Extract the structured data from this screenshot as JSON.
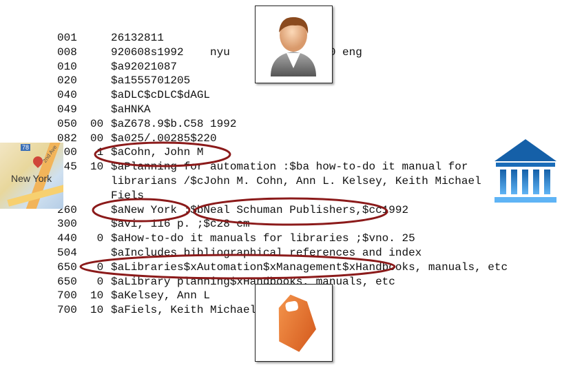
{
  "record": [
    {
      "tag": "001",
      "ind": "",
      "value": "26132811"
    },
    {
      "tag": "008",
      "ind": "",
      "value": "920608s1992    nyu           000 0 eng"
    },
    {
      "tag": "010",
      "ind": "",
      "value": "$a92021087"
    },
    {
      "tag": "020",
      "ind": "",
      "value": "$a1555701205"
    },
    {
      "tag": "040",
      "ind": "",
      "value": "$aDLC$cDLC$dAGL"
    },
    {
      "tag": "049",
      "ind": "",
      "value": "$aHNKA"
    },
    {
      "tag": "050",
      "ind": "00",
      "value": "$aZ678.9$b.C58 1992"
    },
    {
      "tag": "082",
      "ind": "00",
      "value": "$a025/.00285$220"
    },
    {
      "tag": "100",
      "ind": " 1",
      "value": "$aCohn, John M"
    },
    {
      "tag": "245",
      "ind": "10",
      "value": "$aPlanning for automation :$ba how-to-do it manual for"
    },
    {
      "tag": "",
      "ind": "",
      "value": "librarians /$cJohn M. Cohn, Ann L. Kelsey, Keith Michael"
    },
    {
      "tag": "",
      "ind": "",
      "value": "Fiels"
    },
    {
      "tag": "260",
      "ind": "",
      "value": "$aNew York :$bNeal Schuman Publishers,$cc1992"
    },
    {
      "tag": "300",
      "ind": "",
      "value": "$avi, 116 p. ;$c28 cm"
    },
    {
      "tag": "440",
      "ind": " 0",
      "value": "$aHow-to-do it manuals for libraries ;$vno. 25"
    },
    {
      "tag": "504",
      "ind": "",
      "value": "$aIncludes bibliographical references and index"
    },
    {
      "tag": "650",
      "ind": " 0",
      "value": "$aLibraries$xAutomation$xManagement$xHandbooks, manuals, etc"
    },
    {
      "tag": "650",
      "ind": " 0",
      "value": "$aLibrary planning$xHandbooks, manuals, etc"
    },
    {
      "tag": "700",
      "ind": "10",
      "value": "$aKelsey, Ann L"
    },
    {
      "tag": "700",
      "ind": "10",
      "value": "$aFiels, Keith Michael"
    }
  ],
  "map_icon": {
    "label": "New York",
    "street": "2nd Ave",
    "route": "78"
  },
  "icons": [
    "person-icon",
    "map-icon",
    "library-building-icon",
    "tag-icon"
  ],
  "colors": {
    "ellipse": "#8b1a1a",
    "library": "#1e7fd0",
    "tag": "#e8702a"
  }
}
